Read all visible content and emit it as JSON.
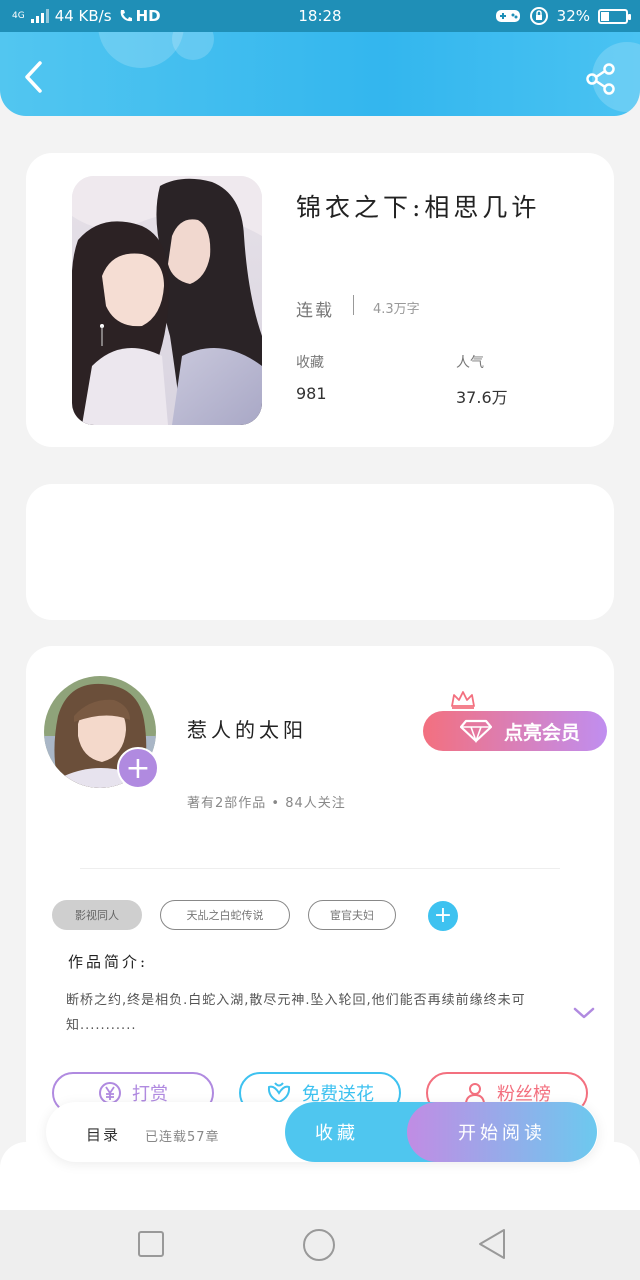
{
  "status_bar": {
    "network": "4G",
    "speed": "44 KB/s",
    "hd": "HD",
    "time": "18:28",
    "battery_text": "32%",
    "battery_level": 0.32
  },
  "book": {
    "title": "锦衣之下:相思几许",
    "status": "连载",
    "words": "4.3万字",
    "fav_label": "收藏",
    "fav_value": "981",
    "pop_label": "人气",
    "pop_value": "37.6万"
  },
  "author": {
    "name": "惹人的太阳",
    "meta": "著有2部作品 • 84人关注",
    "follow_symbol": "+",
    "vip_label": "点亮会员"
  },
  "tags": {
    "items": [
      "影视同人",
      "天乩之白蛇传说",
      "宦官夫妇"
    ],
    "add_symbol": "+"
  },
  "intro": {
    "heading": "作品简介:",
    "text": "断桥之约,终是相负.白蛇入湖,散尽元神.坠入轮回,他们能否再续前缘终未可知..........."
  },
  "actions": {
    "reward": "打赏",
    "flowers": "免费送花",
    "fans": "粉丝榜"
  },
  "bottom_bar": {
    "toc": "目录",
    "chapters": "已连载57章",
    "favorite": "收藏",
    "start_reading": "开始阅读"
  },
  "colors": {
    "header": "#33b6ee",
    "accent_purple": "#b08ae0",
    "accent_pink": "#f3707f",
    "blue_button": "#4fc6ef"
  }
}
